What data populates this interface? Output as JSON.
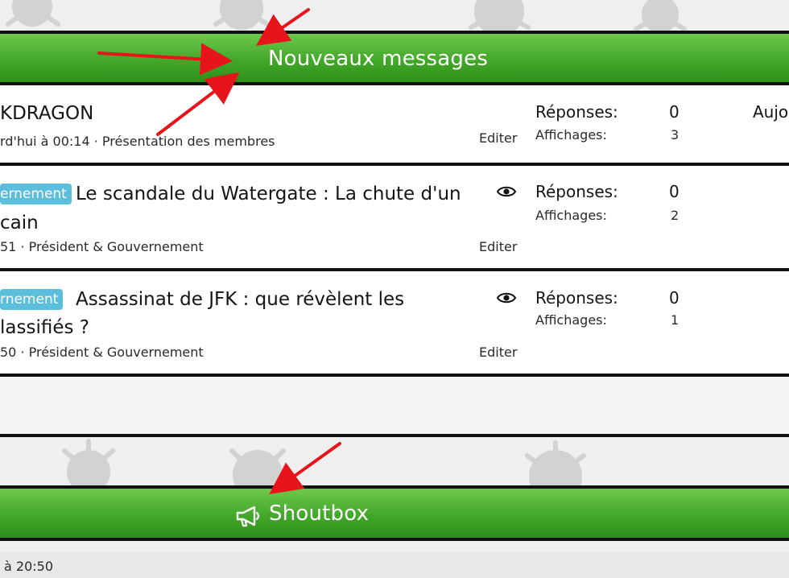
{
  "new_messages": {
    "title": "Nouveaux messages",
    "threads": [
      {
        "title_line1": "KDRAGON",
        "title_line2": "",
        "tag": "",
        "meta": "rd'hui à 00:14 · Présentation des membres",
        "edit_label": "Editer",
        "replies_label": "Réponses:",
        "replies": "0",
        "views_label": "Affichages:",
        "views": "3",
        "last": "Aujo"
      },
      {
        "title_line1": "Le scandale du Watergate : La chute d'un",
        "title_line2": "cain",
        "tag": "ernement",
        "meta": "51 · Président & Gouvernement",
        "edit_label": "Editer",
        "replies_label": "Réponses:",
        "replies": "0",
        "views_label": "Affichages:",
        "views": "2"
      },
      {
        "title_line1": "Assassinat de JFK : que révèlent les",
        "title_line2": "lassifiés ?",
        "tag": "rnement",
        "meta": "50 · Président & Gouvernement",
        "edit_label": "Editer",
        "replies_label": "Réponses:",
        "replies": "0",
        "views_label": "Affichages:",
        "views": "1"
      }
    ]
  },
  "shoutbox": {
    "title": "Shoutbox",
    "icon": "megaphone-icon",
    "first_message_time": "à 20:50"
  },
  "colors": {
    "bar_green": "#43a82a",
    "tag_blue": "#5bbedc",
    "annotation_red": "#e8141b",
    "divider": "#111111"
  }
}
